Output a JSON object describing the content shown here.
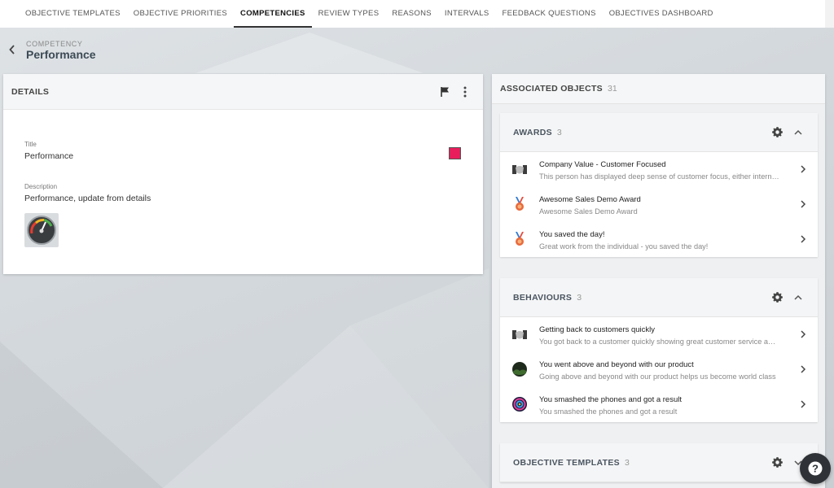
{
  "tabs": [
    {
      "label": "OBJECTIVE TEMPLATES",
      "active": false
    },
    {
      "label": "OBJECTIVE PRIORITIES",
      "active": false
    },
    {
      "label": "COMPETENCIES",
      "active": true
    },
    {
      "label": "REVIEW TYPES",
      "active": false
    },
    {
      "label": "REASONS",
      "active": false
    },
    {
      "label": "INTERVALS",
      "active": false
    },
    {
      "label": "FEEDBACK QUESTIONS",
      "active": false
    },
    {
      "label": "OBJECTIVES DASHBOARD",
      "active": false
    }
  ],
  "header": {
    "overline": "COMPETENCY",
    "title": "Performance",
    "back_icon": "chevron-left-icon"
  },
  "details": {
    "heading": "DETAILS",
    "flag_icon": "flag-icon",
    "more_icon": "more-vertical-icon",
    "title_label": "Title",
    "title_value": "Performance",
    "color": "#e81e5c",
    "description_label": "Description",
    "description_value": "Performance, update from details",
    "image_icon": "gauge-icon"
  },
  "associated": {
    "heading": "ASSOCIATED OBJECTS",
    "count": "31",
    "sections": [
      {
        "title": "AWARDS",
        "count": "3",
        "expanded": true,
        "items": [
          {
            "title": "Company Value - Customer Focused",
            "subtitle": "This person has displayed deep sense of customer focus, either internally or externally",
            "icon": "handshake-icon"
          },
          {
            "title": "Awesome Sales Demo Award",
            "subtitle": "Awesome Sales Demo Award",
            "icon": "medal-icon"
          },
          {
            "title": "You saved the day!",
            "subtitle": "Great work from the individual - you saved the day!",
            "icon": "medal-icon"
          }
        ]
      },
      {
        "title": "BEHAVIOURS",
        "count": "3",
        "expanded": true,
        "items": [
          {
            "title": "Getting back to customers quickly",
            "subtitle": "You got back to a customer quickly showing great customer service and care",
            "icon": "handshake-icon"
          },
          {
            "title": "You went above and beyond with our product",
            "subtitle": "Going above and beyond with our product helps us become world class",
            "icon": "landscape-icon"
          },
          {
            "title": "You smashed the phones and got a result",
            "subtitle": "You smashed the phones and got a result",
            "icon": "target-icon"
          }
        ]
      },
      {
        "title": "OBJECTIVE TEMPLATES",
        "count": "3",
        "expanded": false,
        "items": []
      }
    ]
  },
  "help": {
    "icon": "help-icon",
    "label": "?"
  },
  "colors": {
    "accent": "#e81e5c",
    "fab": "#2f3337"
  }
}
